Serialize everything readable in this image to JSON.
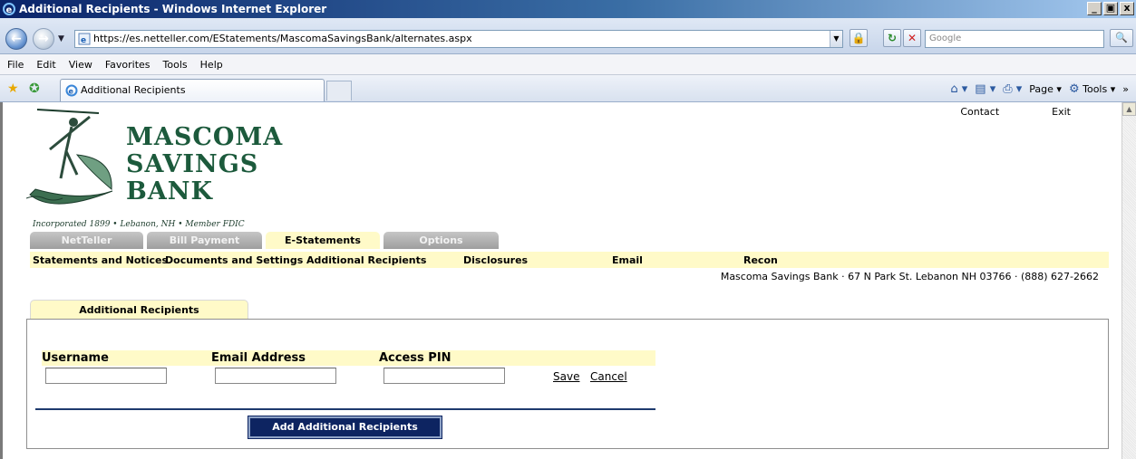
{
  "browser": {
    "title": "Additional Recipients - Windows Internet Explorer",
    "window_buttons": [
      "_",
      "ป",
      "x"
    ],
    "url": "https://es.netteller.com/EStatements/MascomaSavingsBank/alternates.aspx",
    "search_placeholder": "Google",
    "menu": [
      "File",
      "Edit",
      "View",
      "Favorites",
      "Tools",
      "Help"
    ],
    "tab_title": "Additional Recipients",
    "command_bar": {
      "page_label": "Page",
      "tools_label": "Tools"
    }
  },
  "page": {
    "top_links": [
      "Contact",
      "Exit"
    ],
    "bank_name": [
      "MASCOMA",
      "SAVINGS",
      "BANK"
    ],
    "bank_tagline": "Incorporated 1899 • Lebanon, NH • Member FDIC",
    "main_tabs": [
      {
        "label": "NetTeller",
        "active": false
      },
      {
        "label": "Bill Payment",
        "active": false
      },
      {
        "label": "E-Statements",
        "active": true
      },
      {
        "label": "Options",
        "active": false
      }
    ],
    "sub_nav": [
      "Statements and Notices",
      "Documents and Settings",
      "Additional Recipients",
      "Disclosures",
      "Email",
      "Recon"
    ],
    "address_line": "Mascoma Savings Bank · 67 N Park St. Lebanon NH 03766 · (888) 627-2662",
    "panel_tab": "Additional Recipients",
    "form": {
      "col_username": "Username",
      "col_email": "Email Address",
      "col_pin": "Access PIN",
      "username_value": "",
      "email_value": "",
      "pin_value": "",
      "save_label": "Save",
      "cancel_label": "Cancel"
    },
    "add_button": "Add Additional Recipients"
  },
  "colors": {
    "accent_yellow": "#fffac8",
    "navy_button": "#0d2461",
    "logo_green": "#1c5a3c"
  }
}
